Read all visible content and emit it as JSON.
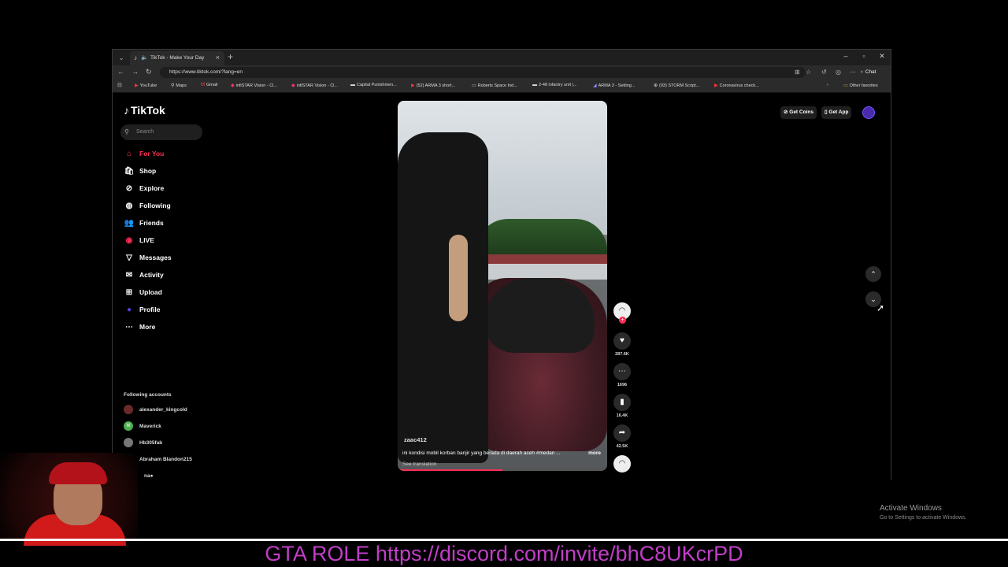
{
  "browser": {
    "tab_title": "TikTok - Make Your Day",
    "url": "https://www.tiktok.com/?lang=en",
    "chat_label": "Chat",
    "bookmarks": [
      {
        "icon": "▶",
        "label": "YouTube"
      },
      {
        "icon": "⚲",
        "label": "Maps"
      },
      {
        "icon": "M",
        "label": "Gmail"
      },
      {
        "icon": "◆",
        "label": "infiSTAR Vision - Cl..."
      },
      {
        "icon": "◆",
        "label": "infiSTAR Vision - Cl..."
      },
      {
        "icon": "▬",
        "label": "Capital Punishmen..."
      },
      {
        "icon": "▶",
        "label": "(52) ARMA 3 short..."
      },
      {
        "icon": "▭",
        "label": "Roberts Space Ind..."
      },
      {
        "icon": "▬",
        "label": "2-48 infantry unit |..."
      },
      {
        "icon": "◢",
        "label": "ARMA 3 - Setting..."
      },
      {
        "icon": "⊕",
        "label": "(93) STORM Script..."
      },
      {
        "icon": "▶",
        "label": "Coronavirus check..."
      }
    ],
    "other_favorites": "Other favorites"
  },
  "tiktok": {
    "logo": "TikTok",
    "search_placeholder": "Search",
    "nav": [
      {
        "icon": "⌂",
        "label": "For You",
        "active": true
      },
      {
        "icon": "🛍",
        "label": "Shop"
      },
      {
        "icon": "⊘",
        "label": "Explore"
      },
      {
        "icon": "◍",
        "label": "Following"
      },
      {
        "icon": "👥",
        "label": "Friends"
      },
      {
        "icon": "◉",
        "label": "LIVE"
      },
      {
        "icon": "▽",
        "label": "Messages"
      },
      {
        "icon": "✉",
        "label": "Activity"
      },
      {
        "icon": "⊞",
        "label": "Upload"
      },
      {
        "icon": "●",
        "label": "Profile"
      },
      {
        "icon": "⋯",
        "label": "More"
      }
    ],
    "following_header": "Following accounts",
    "accounts": [
      {
        "initial": "",
        "name": "alexander_kingcold"
      },
      {
        "initial": "M",
        "name": "Maverick"
      },
      {
        "initial": "",
        "name": "Hb305fab"
      },
      {
        "initial": "",
        "name": "Abraham Blandon215"
      },
      {
        "initial": "",
        "name": "na●"
      },
      {
        "initial": "",
        "name": "ill"
      }
    ],
    "get_coins": "Get Coins",
    "get_app": "Get App",
    "video": {
      "username": "zaac412",
      "caption": "ini kondisi mobil korban banjir yang berada di daerah aceh #medan ...",
      "more": "more",
      "see_translation": "See translation",
      "progress": 0.5
    },
    "actions": {
      "likes": "287.6K",
      "comments": "1696",
      "saves": "16.4K",
      "shares": "42.5K"
    }
  },
  "overlay": {
    "activate_title": "Activate Windows",
    "activate_sub": "Go to Settings to activate Windows.",
    "banner": "GTA  ROLE https://discord.com/invite/bhC8UKcrPD"
  }
}
